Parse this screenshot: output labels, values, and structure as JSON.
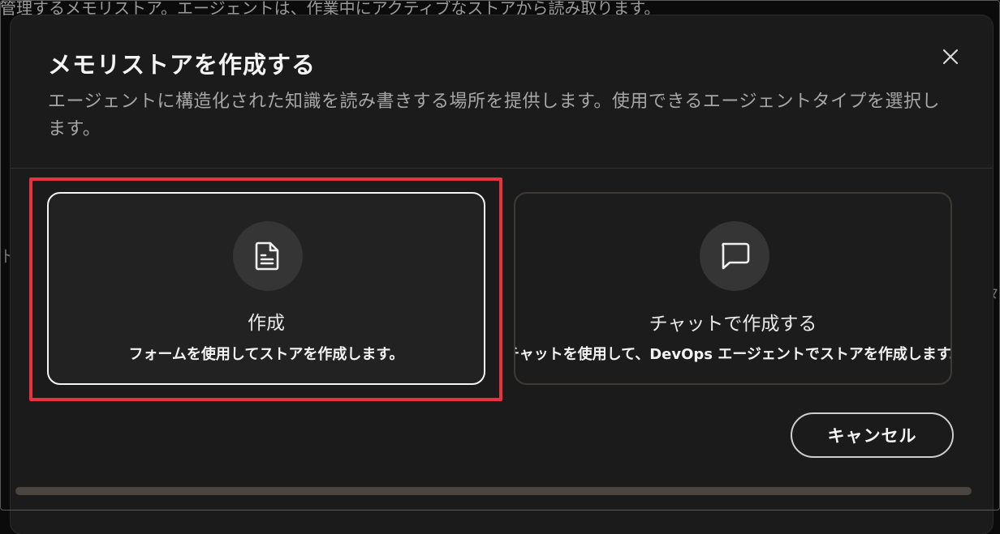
{
  "background": {
    "top_text": "管理するメモリストア。エージェントは、作業中にアクティブなストアから読み取ります。",
    "left_edge_text": "ド",
    "right_edge_text": "々"
  },
  "dialog": {
    "title": "メモリストアを作成する",
    "subtitle": "エージェントに構造化された知識を読み書きする場所を提供します。使用できるエージェントタイプを選択します。",
    "close_icon": "close-icon",
    "options": [
      {
        "icon": "document-icon",
        "title": "作成",
        "description": "フォームを使用してストアを作成します。",
        "selected": true
      },
      {
        "icon": "chat-bubble-icon",
        "title": "チャットで作成する",
        "description": "チャットを使用して、DevOps エージェントでストアを作成します。",
        "selected": false
      }
    ],
    "cancel_label": "キャンセル"
  },
  "colors": {
    "dialog_bg": "#1b1b1b",
    "selected_border": "#f5f5f5",
    "unselected_border": "#3e3a36",
    "highlight": "#e8323f"
  }
}
